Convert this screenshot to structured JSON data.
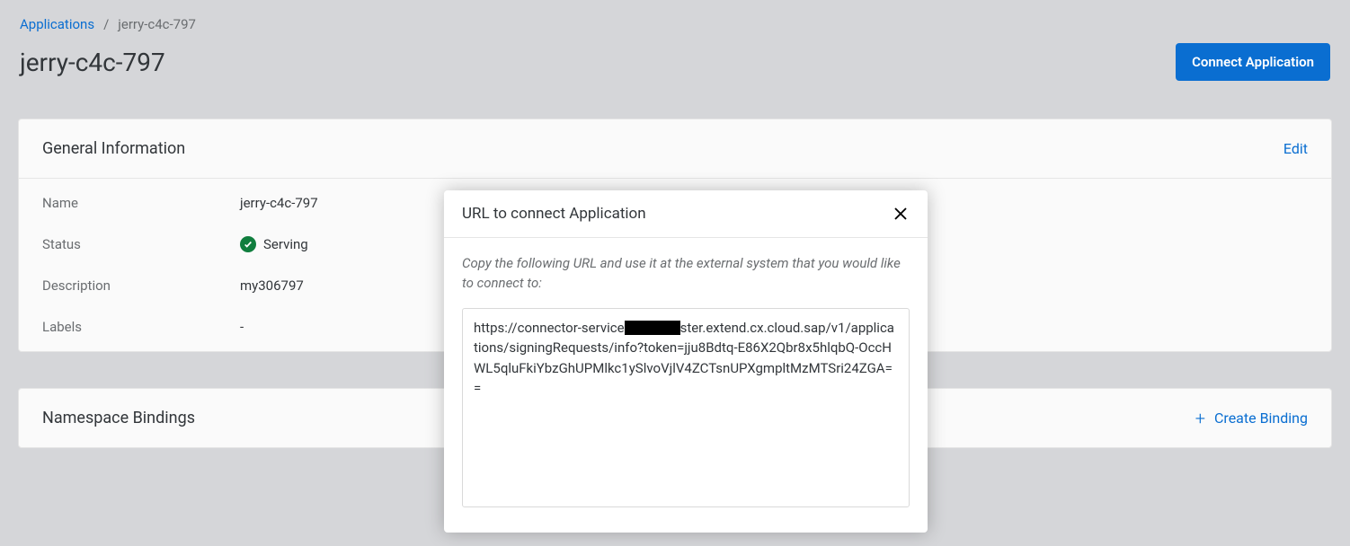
{
  "breadcrumb": {
    "link": "Applications",
    "separator": "/",
    "current": "jerry-c4c-797"
  },
  "header": {
    "title": "jerry-c4c-797",
    "connect_button": "Connect Application"
  },
  "general": {
    "card_title": "General Information",
    "edit": "Edit",
    "fields": {
      "name_label": "Name",
      "name_value": "jerry-c4c-797",
      "status_label": "Status",
      "status_value": "Serving",
      "description_label": "Description",
      "description_value": "my306797",
      "labels_label": "Labels",
      "labels_value": "-"
    }
  },
  "bindings": {
    "card_title": "Namespace Bindings",
    "create": "Create Binding"
  },
  "modal": {
    "title": "URL to connect Application",
    "description": "Copy the following URL and use it at the external system that you would like to connect to:",
    "url_prefix": "https://connector-service",
    "url_suffix": "ster.extend.cx.cloud.sap/v1/applications/signingRequests/info?token=jju8Bdtq-E86X2Qbr8x5hlqbQ-OccHWL5qluFkiYbzGhUPMlkc1ySlvoVjlV4ZCTsnUPXgmpltMzMTSri24ZGA=="
  }
}
